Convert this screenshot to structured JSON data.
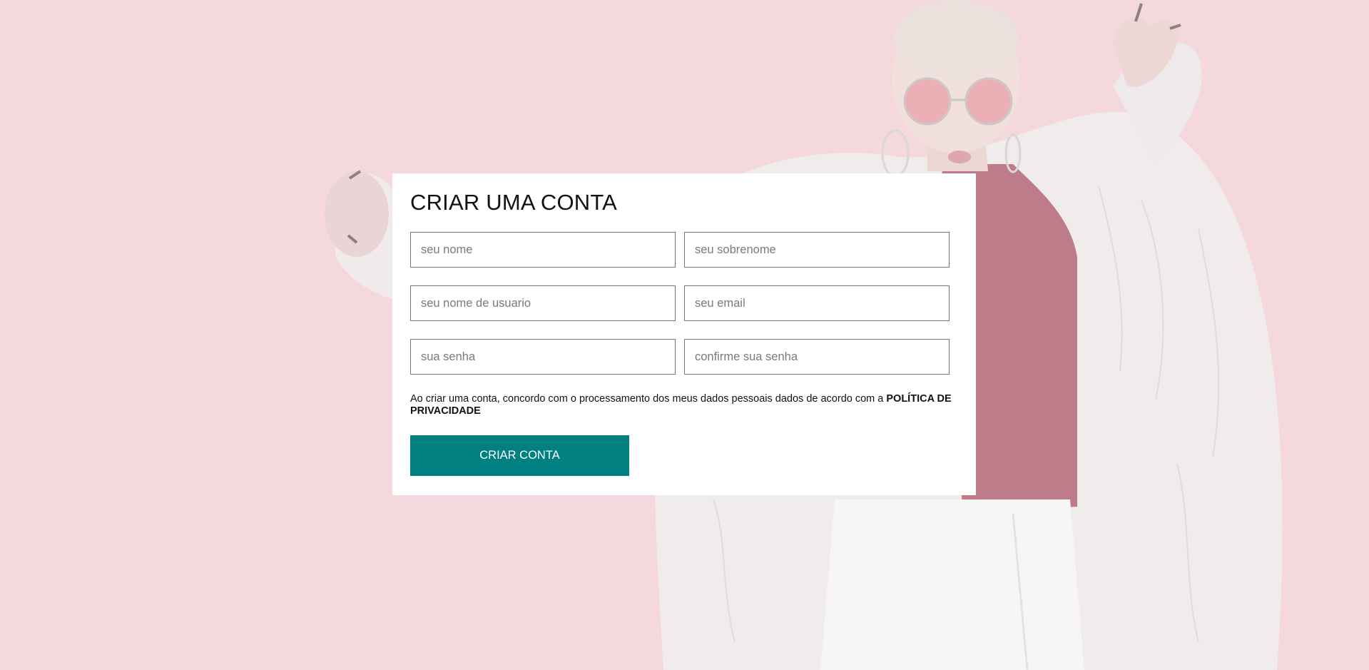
{
  "background": {
    "color": "#f3d3da",
    "accent_color": "#008080"
  },
  "form": {
    "title": "CRIAR UMA CONTA",
    "fields": [
      {
        "name": "first-name-input",
        "placeholder": "seu nome",
        "type": "text"
      },
      {
        "name": "last-name-input",
        "placeholder": "seu sobrenome",
        "type": "text"
      },
      {
        "name": "username-input",
        "placeholder": "seu nome de usuario",
        "type": "text"
      },
      {
        "name": "email-input",
        "placeholder": "seu email",
        "type": "email"
      },
      {
        "name": "password-input",
        "placeholder": "sua senha",
        "type": "password"
      },
      {
        "name": "confirm-password-input",
        "placeholder": "confirme sua senha",
        "type": "password"
      }
    ],
    "consent_text": "Ao criar uma conta, concordo com o processamento dos meus dados pessoais dados de acordo com a ",
    "consent_link": "POLÍTICA DE PRIVACIDADE",
    "submit_label": "CRIAR CONTA"
  }
}
